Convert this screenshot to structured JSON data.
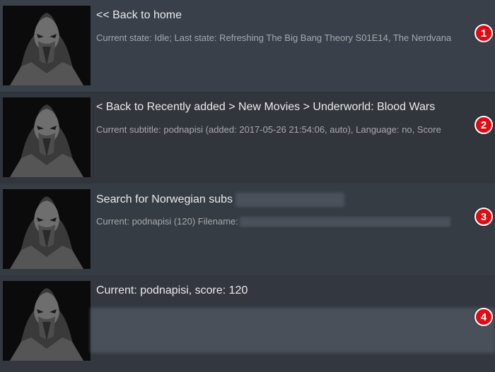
{
  "items": [
    {
      "title": "<< Back to home",
      "subtitle": "Current state: Idle; Last state: Refreshing The Big Bang Theory S01E14, The Nerdvana",
      "badge": "1"
    },
    {
      "title": "< Back to Recently added > New Movies > Underworld: Blood Wars",
      "subtitle": "Current subtitle: podnapisi (added: 2017-05-26 21:54:06, auto), Language: no, Score",
      "badge": "2"
    },
    {
      "title": "Search for Norwegian subs",
      "subtitle": "Current: podnapisi (120) Filename:",
      "badge": "3"
    },
    {
      "title": "Current: podnapisi, score: 120",
      "subtitle": "",
      "badge": "4"
    }
  ],
  "thumbnail_icon": "masked-ninja-thumbnail",
  "badge_color": "#e10b14"
}
